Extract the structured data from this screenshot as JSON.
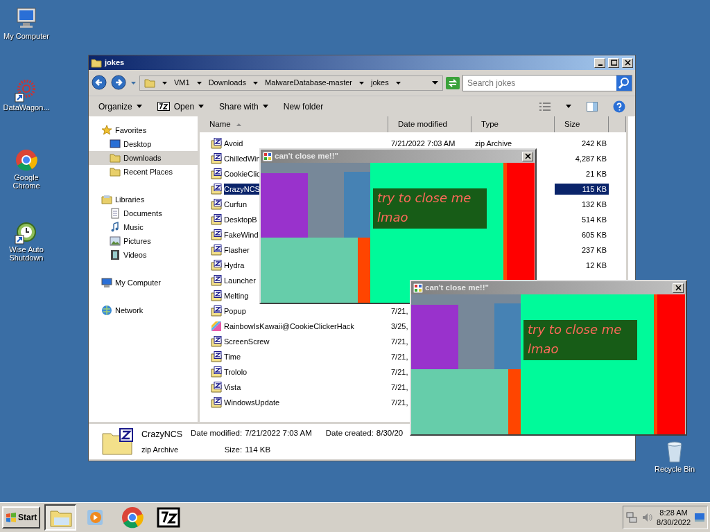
{
  "desktop_icons": [
    {
      "label": "My Computer",
      "kind": "computer"
    },
    {
      "label": "DataWagon...",
      "kind": "datawagon"
    },
    {
      "label": "Google Chrome",
      "kind": "chrome"
    },
    {
      "label": "Wise Auto Shutdown",
      "kind": "shutdown"
    },
    {
      "label": "Recycle Bin",
      "kind": "recycle"
    }
  ],
  "explorer": {
    "title": "jokes",
    "breadcrumb": [
      "VM1",
      "Downloads",
      "MalwareDatabase-master",
      "jokes"
    ],
    "search": {
      "placeholder": "Search jokes"
    },
    "toolbar": [
      {
        "label": "Organize",
        "kind": "menu"
      },
      {
        "label": "Open",
        "kind": "open"
      },
      {
        "label": "Share with",
        "kind": "menu"
      },
      {
        "label": "New folder",
        "kind": "plain"
      }
    ],
    "nav": [
      {
        "label": "Favorites",
        "kind": "star",
        "selected": false,
        "children": [
          {
            "label": "Desktop",
            "kind": "desktop",
            "selected": false
          },
          {
            "label": "Downloads",
            "kind": "downloads",
            "selected": true
          },
          {
            "label": "Recent Places",
            "kind": "recent",
            "selected": false
          }
        ]
      },
      {
        "label": "Libraries",
        "kind": "library",
        "selected": false,
        "children": [
          {
            "label": "Documents",
            "kind": "documents",
            "selected": false
          },
          {
            "label": "Music",
            "kind": "music",
            "selected": false
          },
          {
            "label": "Pictures",
            "kind": "pictures",
            "selected": false
          },
          {
            "label": "Videos",
            "kind": "videos",
            "selected": false
          }
        ]
      },
      {
        "label": "My Computer",
        "kind": "computer",
        "selected": false
      },
      {
        "label": "Network",
        "kind": "network",
        "selected": false
      }
    ],
    "columns": [
      {
        "label": "Name",
        "sorted": true
      },
      {
        "label": "Date modified",
        "sorted": false
      },
      {
        "label": "Type",
        "sorted": false
      },
      {
        "label": "Size",
        "sorted": false
      }
    ],
    "files": [
      {
        "name": "Avoid",
        "date": "7/21/2022 7:03 AM",
        "type": "zip Archive",
        "size": "242 KB",
        "kind": "zip",
        "selected": false
      },
      {
        "name": "ChilledWin",
        "size": "4,287 KB",
        "kind": "zip",
        "selected": false
      },
      {
        "name": "CookieClic",
        "size": "21 KB",
        "kind": "zip",
        "selected": false
      },
      {
        "name": "CrazyNCS",
        "size": "115 KB",
        "kind": "zip",
        "selected": true
      },
      {
        "name": "Curfun",
        "size": "132 KB",
        "kind": "zip",
        "selected": false
      },
      {
        "name": "DesktopB",
        "size": "514 KB",
        "kind": "zip",
        "selected": false
      },
      {
        "name": "FakeWind",
        "size": "605 KB",
        "kind": "zip",
        "selected": false
      },
      {
        "name": "Flasher",
        "size": "237 KB",
        "kind": "zip",
        "selected": false
      },
      {
        "name": "Hydra",
        "size": "12 KB",
        "kind": "zip",
        "selected": false
      },
      {
        "name": "Launcher",
        "kind": "zip",
        "selected": false
      },
      {
        "name": "Melting",
        "kind": "zip",
        "selected": false
      },
      {
        "name": "Popup",
        "date": "7/21,",
        "kind": "zip",
        "selected": false
      },
      {
        "name": "RainbowIsKawaii@CookieClickerHack",
        "date": "3/25,",
        "kind": "image",
        "selected": false
      },
      {
        "name": "ScreenScrew",
        "date": "7/21,",
        "kind": "zip",
        "selected": false
      },
      {
        "name": "Time",
        "date": "7/21,",
        "kind": "zip",
        "selected": false
      },
      {
        "name": "Trololo",
        "date": "7/21,",
        "kind": "zip",
        "selected": false
      },
      {
        "name": "Vista",
        "date": "7/21,",
        "kind": "zip",
        "selected": false
      },
      {
        "name": "WindowsUpdate",
        "date": "7/21,",
        "kind": "zip",
        "selected": false
      }
    ],
    "details": {
      "name": "CrazyNCS",
      "type": "zip Archive",
      "fields": [
        {
          "label": "Date modified:",
          "value": "7/21/2022 7:03 AM"
        },
        {
          "label": "Size:",
          "value": "114 KB"
        },
        {
          "label": "Date created:",
          "value": "8/30/20"
        }
      ]
    }
  },
  "popups": [
    {
      "title": "can't close me!!\"",
      "message": "try to close me lmao"
    },
    {
      "title": "can't close me!!\"",
      "message": "try to close me lmao"
    }
  ],
  "taskbar": {
    "start": "Start",
    "apps": [
      {
        "kind": "explorer",
        "active": true
      },
      {
        "kind": "media",
        "active": false
      },
      {
        "kind": "chrome",
        "active": false
      },
      {
        "kind": "sevenzip",
        "active": false
      }
    ],
    "time": "8:28 AM",
    "date": "8/30/2022"
  }
}
